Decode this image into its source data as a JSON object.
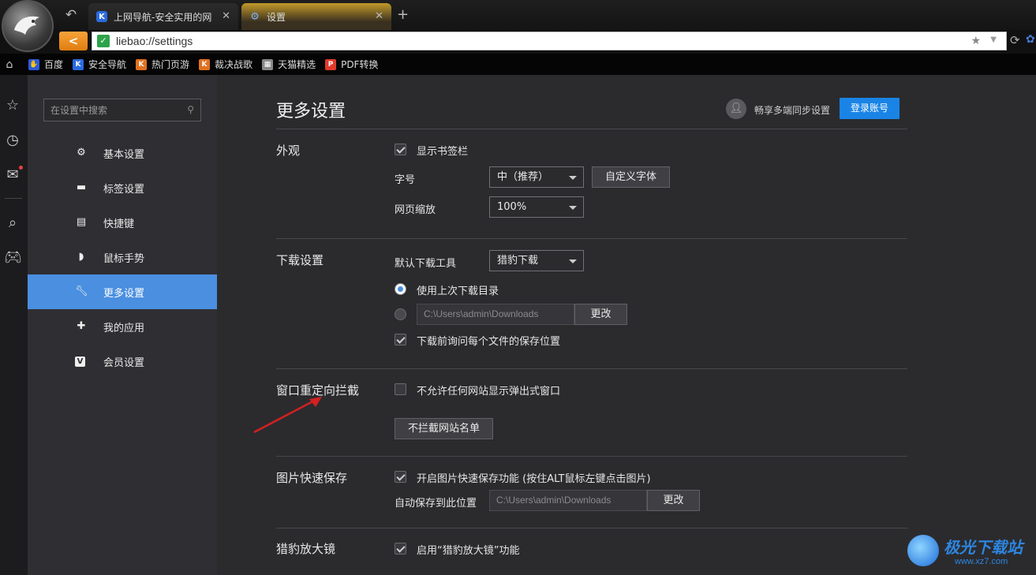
{
  "window": {
    "tabs": [
      {
        "label": "上网导航-安全实用的网",
        "favicon": "K"
      },
      {
        "label": "设置",
        "favicon": "gear-icon"
      }
    ],
    "new_tab": "+",
    "close": "✕"
  },
  "address_bar": {
    "url": "liebao://settings"
  },
  "bookmarks": [
    {
      "label": "百度",
      "icon_color": "#2a5cd8",
      "icon": "baidu-icon"
    },
    {
      "label": "安全导航",
      "icon_color": "#2a6be0",
      "icon": "k-shield-icon"
    },
    {
      "label": "热门页游",
      "icon_color": "#e07020",
      "icon": "k-shield-orange-icon"
    },
    {
      "label": "裁决战歌",
      "icon_color": "#e07020",
      "icon": "k-shield-orange-icon"
    },
    {
      "label": "天猫精选",
      "icon_color": "#888888",
      "icon": "tmall-icon"
    },
    {
      "label": "PDF转换",
      "icon_color": "#e03a2a",
      "icon": "pdf-icon"
    }
  ],
  "sidebar": {
    "search_placeholder": "在设置中搜索",
    "items": [
      {
        "label": "基本设置",
        "icon": "gear-icon"
      },
      {
        "label": "标签设置",
        "icon": "tab-icon"
      },
      {
        "label": "快捷键",
        "icon": "keyboard-icon"
      },
      {
        "label": "鼠标手势",
        "icon": "mouse-icon"
      },
      {
        "label": "更多设置",
        "icon": "wrench-icon",
        "active": true
      },
      {
        "label": "我的应用",
        "icon": "puzzle-icon"
      },
      {
        "label": "会员设置",
        "icon": "vip-icon"
      }
    ]
  },
  "main": {
    "title": "更多设置",
    "sync_text": "畅享多端同步设置",
    "login_button": "登录账号",
    "appearance": {
      "title": "外观",
      "show_bookmarks": "显示书签栏",
      "font_size_label": "字号",
      "font_size_value": "中（推荐）",
      "custom_font_button": "自定义字体",
      "zoom_label": "网页缩放",
      "zoom_value": "100%"
    },
    "download": {
      "title": "下载设置",
      "default_tool_label": "默认下载工具",
      "default_tool_value": "猎豹下载",
      "use_last_dir": "使用上次下载目录",
      "path": "C:\\Users\\admin\\Downloads",
      "change_button": "更改",
      "ask_location": "下载前询问每个文件的保存位置"
    },
    "popup": {
      "title": "窗口重定向拦截",
      "block_all": "不允许任何网站显示弹出式窗口",
      "whitelist_button": "不拦截网站名单"
    },
    "image_save": {
      "title": "图片快速保存",
      "enable": "开启图片快速保存功能 (按住ALT鼠标左键点击图片)",
      "auto_save_label": "自动保存到此位置",
      "path": "C:\\Users\\admin\\Downloads",
      "change_button": "更改"
    },
    "magnifier": {
      "title": "猎豹放大镜",
      "enable": "启用“猎豹放大镜”功能"
    }
  },
  "watermark": {
    "text": "极光下载站",
    "url": "www.xz7.com"
  },
  "colors": {
    "accent": "#4a8fe0",
    "login": "#1a84e6",
    "arrow": "#d42020"
  }
}
